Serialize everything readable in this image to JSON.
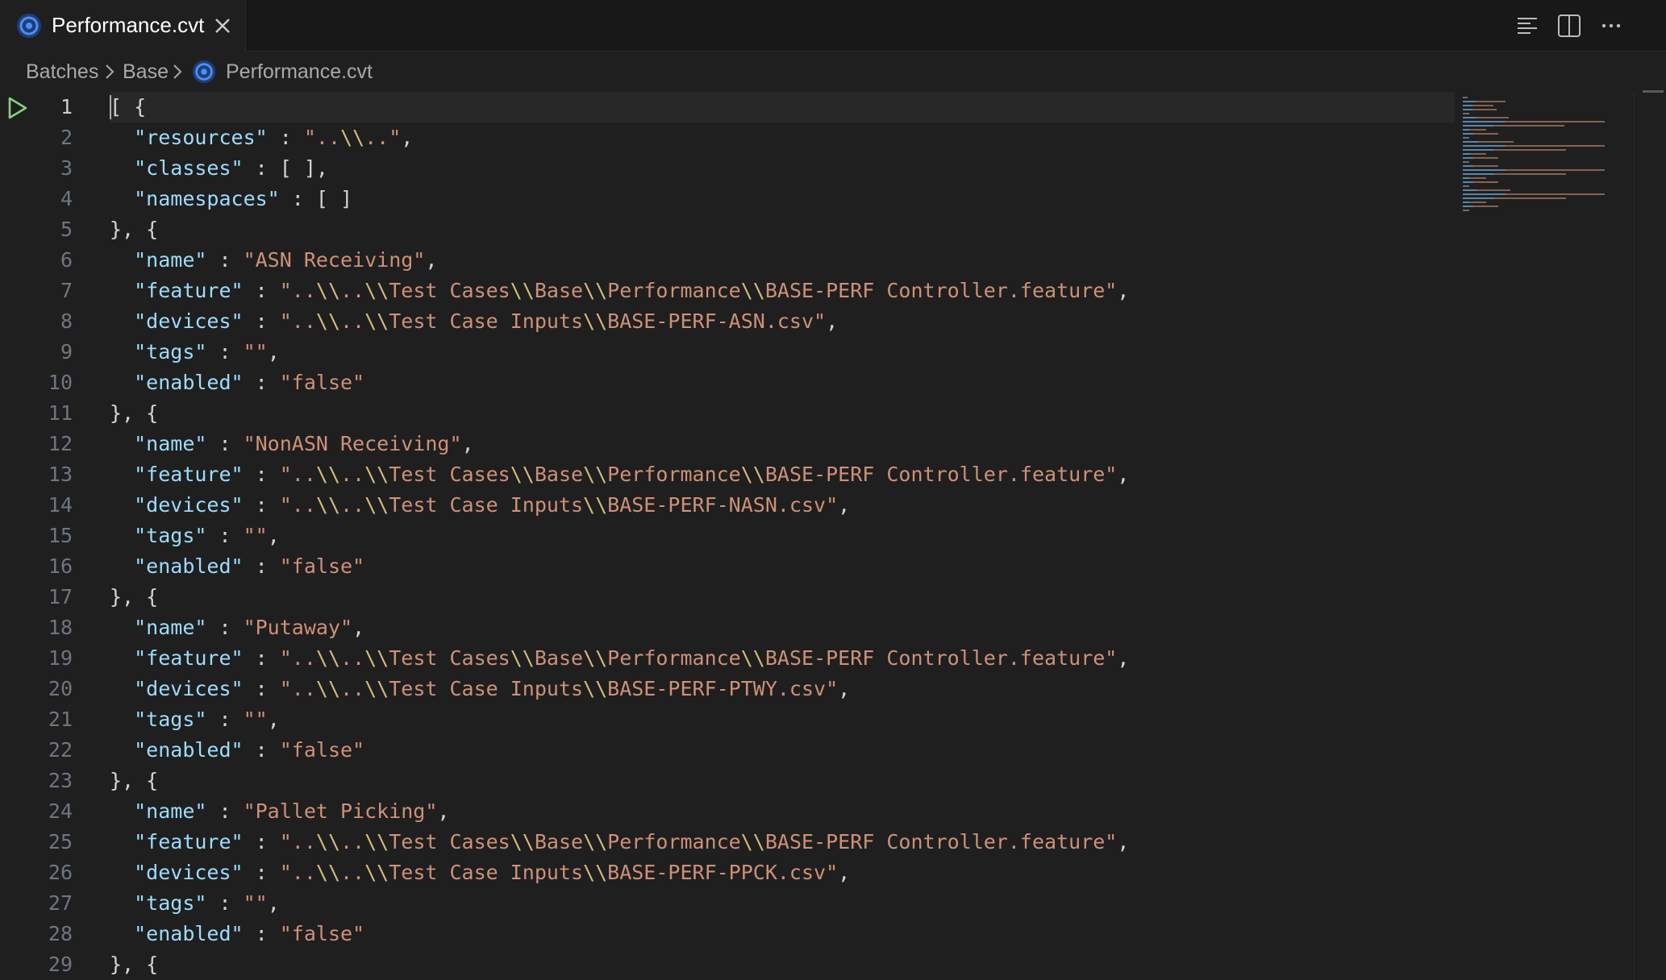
{
  "tab": {
    "title": "Performance.cvt"
  },
  "breadcrumb": {
    "items": [
      "Batches",
      "Base",
      "Performance.cvt"
    ]
  },
  "editor": {
    "active_line": 1,
    "lines": [
      "[ {",
      "  \"resources\" : \"..\\\\..\",",
      "  \"classes\" : [ ],",
      "  \"namespaces\" : [ ]",
      "}, {",
      "  \"name\" : \"ASN Receiving\",",
      "  \"feature\" : \"..\\\\..\\\\Test Cases\\\\Base\\\\Performance\\\\BASE-PERF Controller.feature\",",
      "  \"devices\" : \"..\\\\..\\\\Test Case Inputs\\\\BASE-PERF-ASN.csv\",",
      "  \"tags\" : \"\",",
      "  \"enabled\" : \"false\"",
      "}, {",
      "  \"name\" : \"NonASN Receiving\",",
      "  \"feature\" : \"..\\\\..\\\\Test Cases\\\\Base\\\\Performance\\\\BASE-PERF Controller.feature\",",
      "  \"devices\" : \"..\\\\..\\\\Test Case Inputs\\\\BASE-PERF-NASN.csv\",",
      "  \"tags\" : \"\",",
      "  \"enabled\" : \"false\"",
      "}, {",
      "  \"name\" : \"Putaway\",",
      "  \"feature\" : \"..\\\\..\\\\Test Cases\\\\Base\\\\Performance\\\\BASE-PERF Controller.feature\",",
      "  \"devices\" : \"..\\\\..\\\\Test Case Inputs\\\\BASE-PERF-PTWY.csv\",",
      "  \"tags\" : \"\",",
      "  \"enabled\" : \"false\"",
      "}, {",
      "  \"name\" : \"Pallet Picking\",",
      "  \"feature\" : \"..\\\\..\\\\Test Cases\\\\Base\\\\Performance\\\\BASE-PERF Controller.feature\",",
      "  \"devices\" : \"..\\\\..\\\\Test Case Inputs\\\\BASE-PERF-PPCK.csv\",",
      "  \"tags\" : \"\",",
      "  \"enabled\" : \"false\"",
      "}, {"
    ]
  },
  "icons": {
    "file": "circular-file-icon",
    "close": "close-icon",
    "outline": "outline-icon",
    "split": "split-editor-icon",
    "more": "more-actions-icon",
    "run": "run-play-icon",
    "chevron": "chevron-right-icon"
  },
  "colors": {
    "background": "#1f1f1f",
    "tabbar": "#181818",
    "key": "#9cdcfe",
    "string": "#ce9178",
    "escape": "#d7ba7d",
    "line_number": "#6e7681",
    "run_glyph": "#89d185",
    "file_icon": "#2f6fd6"
  }
}
